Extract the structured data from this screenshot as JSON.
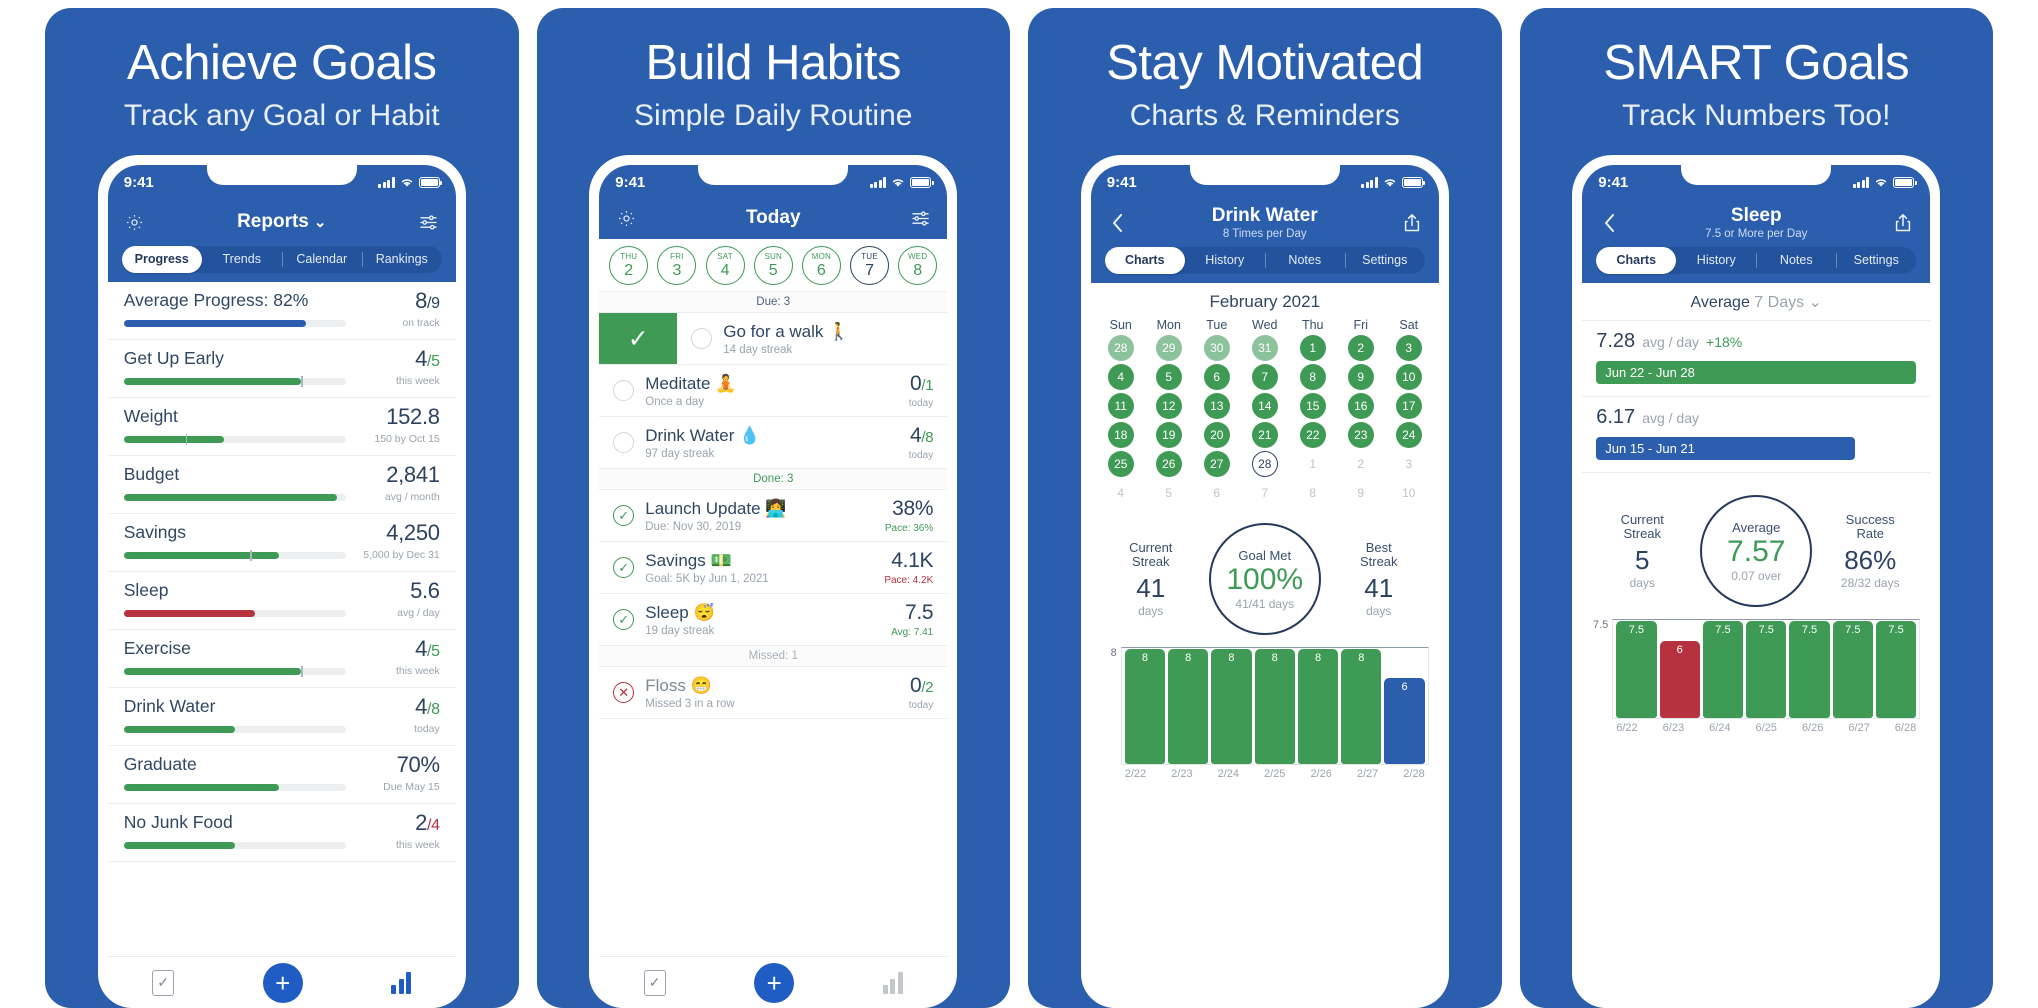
{
  "panels": [
    {
      "headline": "Achieve Goals",
      "subhead": "Track any Goal or Habit",
      "status": {
        "time": "9:41"
      },
      "nav": {
        "title": "Reports",
        "chevron": "⌄"
      },
      "tabs": [
        {
          "label": "Progress",
          "active": true
        },
        {
          "label": "Trends",
          "active": false
        },
        {
          "label": "Calendar",
          "active": false
        },
        {
          "label": "Rankings",
          "active": false
        }
      ],
      "rows": [
        {
          "name": "Average Progress: 82%",
          "value": "8",
          "den": "/9",
          "note": "on track",
          "pct": 82,
          "color": "#2b5fae",
          "marker": null,
          "den_color": "#2c4260"
        },
        {
          "name": "Get Up Early",
          "value": "4",
          "den": "/5",
          "note": "this week",
          "pct": 80,
          "color": "#3e9a55",
          "marker": 80,
          "den_color": "#3e9a55"
        },
        {
          "name": "Weight",
          "value": "152.8",
          "den": "",
          "note": "150 by Oct 15",
          "pct": 45,
          "color": "#3e9a55",
          "marker": 28,
          "den_color": "#2c4260"
        },
        {
          "name": "Budget",
          "value": "2,841",
          "den": "",
          "note": "avg / month",
          "pct": 96,
          "color": "#3e9a55",
          "marker": null,
          "den_color": "#2c4260"
        },
        {
          "name": "Savings",
          "value": "4,250",
          "den": "",
          "note": "5,000 by Dec 31",
          "pct": 70,
          "color": "#3e9a55",
          "marker": 57,
          "den_color": "#2c4260"
        },
        {
          "name": "Sleep",
          "value": "5.6",
          "den": "",
          "note": "avg / day",
          "pct": 59,
          "color": "#b7323f",
          "marker": null,
          "den_color": "#2c4260"
        },
        {
          "name": "Exercise",
          "value": "4",
          "den": "/5",
          "note": "this week",
          "pct": 80,
          "color": "#3e9a55",
          "marker": 80,
          "den_color": "#3e9a55"
        },
        {
          "name": "Drink Water",
          "value": "4",
          "den": "/8",
          "note": "today",
          "pct": 50,
          "color": "#3e9a55",
          "marker": null,
          "den_color": "#3e9a55"
        },
        {
          "name": "Graduate",
          "value": "70%",
          "den": "",
          "note": "Due May 15",
          "pct": 70,
          "color": "#3e9a55",
          "marker": null,
          "den_color": "#2c4260"
        },
        {
          "name": "No Junk Food",
          "value": "2",
          "den": "/4",
          "note": "this week",
          "pct": 50,
          "color": "#3e9a55",
          "marker": null,
          "den_color": "#b7323f"
        }
      ],
      "toolbar": {
        "check": "check-list-icon",
        "plus": "+",
        "chart": "bar-chart-icon"
      }
    },
    {
      "headline": "Build Habits",
      "subhead": "Simple Daily Routine",
      "status": {
        "time": "9:41"
      },
      "nav": {
        "title": "Today",
        "chevron": ""
      },
      "week": [
        {
          "dow": "THU",
          "day": "2",
          "today": false
        },
        {
          "dow": "FRI",
          "day": "3",
          "today": false
        },
        {
          "dow": "SAT",
          "day": "4",
          "today": false
        },
        {
          "dow": "SUN",
          "day": "5",
          "today": false
        },
        {
          "dow": "MON",
          "day": "6",
          "today": false
        },
        {
          "dow": "TUE",
          "day": "7",
          "today": true
        },
        {
          "dow": "WED",
          "day": "8",
          "today": false
        }
      ],
      "sections": [
        {
          "header": "Due: 3",
          "kind": "due",
          "tasks": [
            {
              "name": "Go for a walk",
              "emoji": "🚶",
              "sub": "14 day streak",
              "value": "",
              "den": "",
              "note": "",
              "note_kind": "",
              "state": "swipe"
            },
            {
              "name": "Meditate",
              "emoji": "🧘",
              "sub": "Once a day",
              "value": "0",
              "den": "/1",
              "note": "today",
              "note_kind": "",
              "state": "open"
            },
            {
              "name": "Drink Water",
              "emoji": "💧",
              "sub": "97 day streak",
              "value": "4",
              "den": "/8",
              "note": "today",
              "note_kind": "",
              "state": "open"
            }
          ]
        },
        {
          "header": "Done: 3",
          "kind": "done",
          "tasks": [
            {
              "name": "Launch Update",
              "emoji": "👩‍💻",
              "sub": "Due: Nov 30, 2019",
              "value": "38%",
              "den": "",
              "note": "Pace: 36%",
              "note_kind": "green",
              "state": "done"
            },
            {
              "name": "Savings",
              "emoji": "💵",
              "sub": "Goal: 5K by Jun 1, 2021",
              "value": "4.1K",
              "den": "",
              "note": "Pace: 4.2K",
              "note_kind": "red",
              "state": "done"
            },
            {
              "name": "Sleep",
              "emoji": "😴",
              "sub": "19 day streak",
              "value": "7.5",
              "den": "",
              "note": "Avg: 7.41",
              "note_kind": "green",
              "state": "done"
            }
          ]
        },
        {
          "header": "Missed: 1",
          "kind": "missed",
          "tasks": [
            {
              "name": "Floss",
              "emoji": "😁",
              "sub": "Missed 3 in a row",
              "value": "0",
              "den": "/2",
              "note": "today",
              "note_kind": "",
              "state": "missed"
            }
          ]
        }
      ],
      "toolbar": {
        "check": "check-list-icon",
        "plus": "+",
        "chart": "bar-chart-icon"
      }
    },
    {
      "headline": "Stay Motivated",
      "subhead": "Charts & Reminders",
      "status": {
        "time": "9:41"
      },
      "nav": {
        "title": "Drink Water",
        "subtitle": "8 Times per Day"
      },
      "tabs": [
        {
          "label": "Charts",
          "active": true
        },
        {
          "label": "History",
          "active": false
        },
        {
          "label": "Notes",
          "active": false
        },
        {
          "label": "Settings",
          "active": false
        }
      ],
      "calendar": {
        "month": "February 2021",
        "dow": [
          "Sun",
          "Mon",
          "Tue",
          "Wed",
          "Thu",
          "Fri",
          "Sat"
        ],
        "weeks": [
          [
            {
              "d": "28",
              "s": "gl"
            },
            {
              "d": "29",
              "s": "gl"
            },
            {
              "d": "30",
              "s": "gl"
            },
            {
              "d": "31",
              "s": "gl"
            },
            {
              "d": "1",
              "s": "g"
            },
            {
              "d": "2",
              "s": "g"
            },
            {
              "d": "3",
              "s": "g"
            }
          ],
          [
            {
              "d": "4",
              "s": "g"
            },
            {
              "d": "5",
              "s": "g"
            },
            {
              "d": "6",
              "s": "g"
            },
            {
              "d": "7",
              "s": "g"
            },
            {
              "d": "8",
              "s": "g"
            },
            {
              "d": "9",
              "s": "g"
            },
            {
              "d": "10",
              "s": "g"
            }
          ],
          [
            {
              "d": "11",
              "s": "g"
            },
            {
              "d": "12",
              "s": "g"
            },
            {
              "d": "13",
              "s": "g"
            },
            {
              "d": "14",
              "s": "g"
            },
            {
              "d": "15",
              "s": "g"
            },
            {
              "d": "16",
              "s": "g"
            },
            {
              "d": "17",
              "s": "g"
            }
          ],
          [
            {
              "d": "18",
              "s": "g"
            },
            {
              "d": "19",
              "s": "g"
            },
            {
              "d": "20",
              "s": "g"
            },
            {
              "d": "21",
              "s": "g"
            },
            {
              "d": "22",
              "s": "g"
            },
            {
              "d": "23",
              "s": "g"
            },
            {
              "d": "24",
              "s": "g"
            }
          ],
          [
            {
              "d": "25",
              "s": "g"
            },
            {
              "d": "26",
              "s": "g"
            },
            {
              "d": "27",
              "s": "g"
            },
            {
              "d": "28",
              "s": "today"
            },
            {
              "d": "1",
              "s": "out"
            },
            {
              "d": "2",
              "s": "out"
            },
            {
              "d": "3",
              "s": "out"
            }
          ],
          [
            {
              "d": "4",
              "s": "out"
            },
            {
              "d": "5",
              "s": "out"
            },
            {
              "d": "6",
              "s": "out"
            },
            {
              "d": "7",
              "s": "out"
            },
            {
              "d": "8",
              "s": "out"
            },
            {
              "d": "9",
              "s": "out"
            },
            {
              "d": "10",
              "s": "out"
            }
          ]
        ]
      },
      "stats": {
        "left": {
          "label1": "Current",
          "label2": "Streak",
          "value": "41",
          "unit": "days"
        },
        "ring": {
          "label": "Goal Met",
          "value": "100%",
          "sub": "41/41 days"
        },
        "right": {
          "label1": "Best",
          "label2": "Streak",
          "value": "41",
          "unit": "days"
        }
      },
      "chart_data": {
        "type": "bar",
        "title": "Drink Water — last 7 days",
        "categories": [
          "2/22",
          "2/23",
          "2/24",
          "2/25",
          "2/26",
          "2/27",
          "2/28"
        ],
        "values": [
          8,
          8,
          8,
          8,
          8,
          8,
          6
        ],
        "colors": [
          "green",
          "green",
          "green",
          "green",
          "green",
          "green",
          "blue"
        ],
        "ylabel": "8",
        "ylim": [
          0,
          8
        ],
        "grid": false,
        "legend": "none"
      },
      "toolbar": null
    },
    {
      "headline": "SMART Goals",
      "subhead": "Track Numbers Too!",
      "status": {
        "time": "9:41"
      },
      "nav": {
        "title": "Sleep",
        "subtitle": "7.5 or More per Day"
      },
      "tabs": [
        {
          "label": "Charts",
          "active": true
        },
        {
          "label": "History",
          "active": false
        },
        {
          "label": "Notes",
          "active": false
        },
        {
          "label": "Settings",
          "active": false
        }
      ],
      "avg_header": {
        "text": "Average",
        "period": "7 Days",
        "chevron": "⌄"
      },
      "avg_rows": [
        {
          "num": "7.28",
          "unit": "avg / day",
          "delta": "+18%",
          "range": "Jun 22 - Jun 28",
          "bar": "green",
          "width": 100
        },
        {
          "num": "6.17",
          "unit": "avg / day",
          "delta": "",
          "range": "Jun 15 - Jun 21",
          "bar": "blue",
          "width": 81
        }
      ],
      "stats": {
        "left": {
          "label1": "Current",
          "label2": "Streak",
          "value": "5",
          "unit": "days"
        },
        "ring": {
          "label": "Average",
          "value": "7.57",
          "sub": "0.07 over"
        },
        "right": {
          "label1": "Success",
          "label2": "Rate",
          "value": "86%",
          "unit": "28/32 days"
        }
      },
      "chart_data": {
        "type": "bar",
        "title": "Sleep — last 7 days",
        "categories": [
          "6/22",
          "6/23",
          "6/24",
          "6/25",
          "6/26",
          "6/27",
          "6/28"
        ],
        "values": [
          7.5,
          6,
          7.5,
          7.5,
          7.5,
          7.5,
          7.5
        ],
        "colors": [
          "green",
          "red",
          "green",
          "green",
          "green",
          "green",
          "green"
        ],
        "ylabel": "7.5",
        "ylim": [
          0,
          7.5
        ],
        "grid": false,
        "legend": "none"
      },
      "toolbar": null
    }
  ],
  "theme": {
    "blue": "#2b5fae",
    "green": "#3e9a55",
    "red": "#b7323f",
    "navy": "#2c4260",
    "gray": "#9aa3ae"
  }
}
